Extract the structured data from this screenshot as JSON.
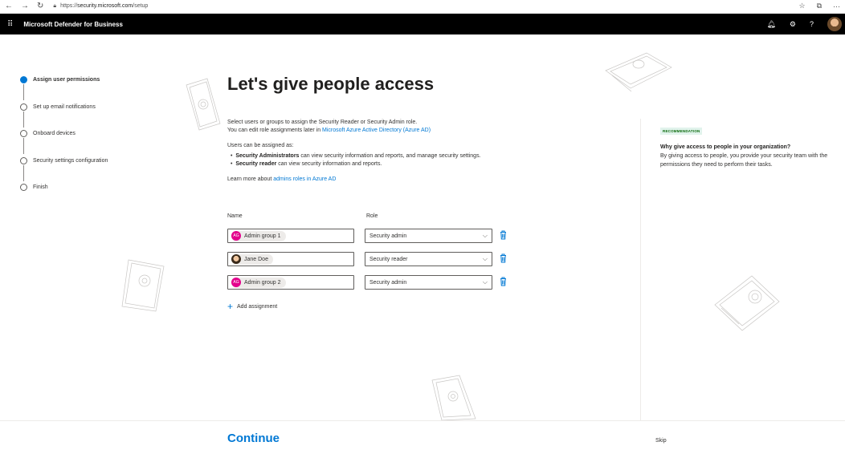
{
  "browser": {
    "url_prefix": "https://",
    "url_host": "security.microsoft.com",
    "url_path": "/setup"
  },
  "app": {
    "title": "Microsoft Defender for Business"
  },
  "steps": [
    {
      "label": "Assign user permissions",
      "active": true
    },
    {
      "label": "Set up email notifications",
      "active": false
    },
    {
      "label": "Onboard devices",
      "active": false
    },
    {
      "label": "Security settings configuration",
      "active": false
    },
    {
      "label": "Finish",
      "active": false
    }
  ],
  "main": {
    "heading": "Let's give people access",
    "intro_line1": "Select users or groups to assign the Security Reader or Security Admin role.",
    "intro_line2_prefix": "You can edit role assignments later in ",
    "intro_line2_link": "Microsoft Azure Active Directory (Azure AD)",
    "assign_intro": "Users can be assigned as:",
    "bullet1_bold": "Security Administrators",
    "bullet1_rest": " can view security information and reports, and manage security settings.",
    "bullet2_bold": "Security reader",
    "bullet2_rest": " can view security information and reports.",
    "learn_prefix": "Learn more about ",
    "learn_link": "admins roles in Azure AD",
    "col_name": "Name",
    "col_role": "Role",
    "add_label": "Add assignment"
  },
  "assignments": [
    {
      "initials": "AG",
      "name": "Admin group 1",
      "role": "Security admin"
    },
    {
      "initials": "",
      "name": "Jane Doe",
      "role": "Security reader"
    },
    {
      "initials": "AG",
      "name": "Admin group 2",
      "role": "Security admin"
    }
  ],
  "recommendation": {
    "badge": "RECOMMENDATION",
    "question": "Why give access to people in your organization?",
    "answer": "By giving access to people, you provide your security team with the permissions they need to perform their tasks."
  },
  "footer": {
    "continue_label": "Continue",
    "skip_label": "Skip"
  },
  "colors": {
    "accent": "#0078d4",
    "initials_bg": "#e3008c",
    "appbar_bg": "#000000"
  }
}
